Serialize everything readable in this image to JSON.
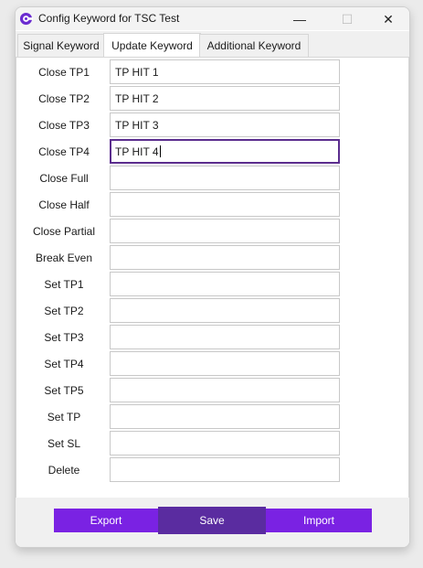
{
  "window": {
    "title": "Config Keyword for TSC Test",
    "minimize_glyph": "—",
    "maximize_glyph": "☐",
    "close_glyph": "✕"
  },
  "tabs": [
    {
      "label": "Signal Keyword",
      "active": false
    },
    {
      "label": "Update Keyword",
      "active": true
    },
    {
      "label": "Additional Keyword",
      "active": false
    }
  ],
  "rows": [
    {
      "label": "Close TP1",
      "value": "TP HIT 1"
    },
    {
      "label": "Close TP2",
      "value": "TP HIT 2"
    },
    {
      "label": "Close TP3",
      "value": "TP HIT 3"
    },
    {
      "label": "Close TP4",
      "value": "TP HIT 4",
      "focused": true
    },
    {
      "label": "Close Full",
      "value": ""
    },
    {
      "label": "Close Half",
      "value": ""
    },
    {
      "label": "Close Partial",
      "value": ""
    },
    {
      "label": "Break Even",
      "value": ""
    },
    {
      "label": "Set TP1",
      "value": ""
    },
    {
      "label": "Set TP2",
      "value": ""
    },
    {
      "label": "Set TP3",
      "value": ""
    },
    {
      "label": "Set TP4",
      "value": ""
    },
    {
      "label": "Set TP5",
      "value": ""
    },
    {
      "label": "Set TP",
      "value": ""
    },
    {
      "label": "Set SL",
      "value": ""
    },
    {
      "label": "Delete",
      "value": ""
    }
  ],
  "footer": {
    "export_label": "Export",
    "save_label": "Save",
    "import_label": "Import"
  },
  "colors": {
    "accent": "#7a22e3",
    "accent_dark": "#5a2ca0",
    "focus_border": "#5b2d8e",
    "app_icon": "#6a2bd0"
  },
  "icons": {
    "app": "app-logo-icon",
    "minimize": "minimize-icon",
    "maximize": "maximize-icon",
    "close": "close-icon"
  }
}
